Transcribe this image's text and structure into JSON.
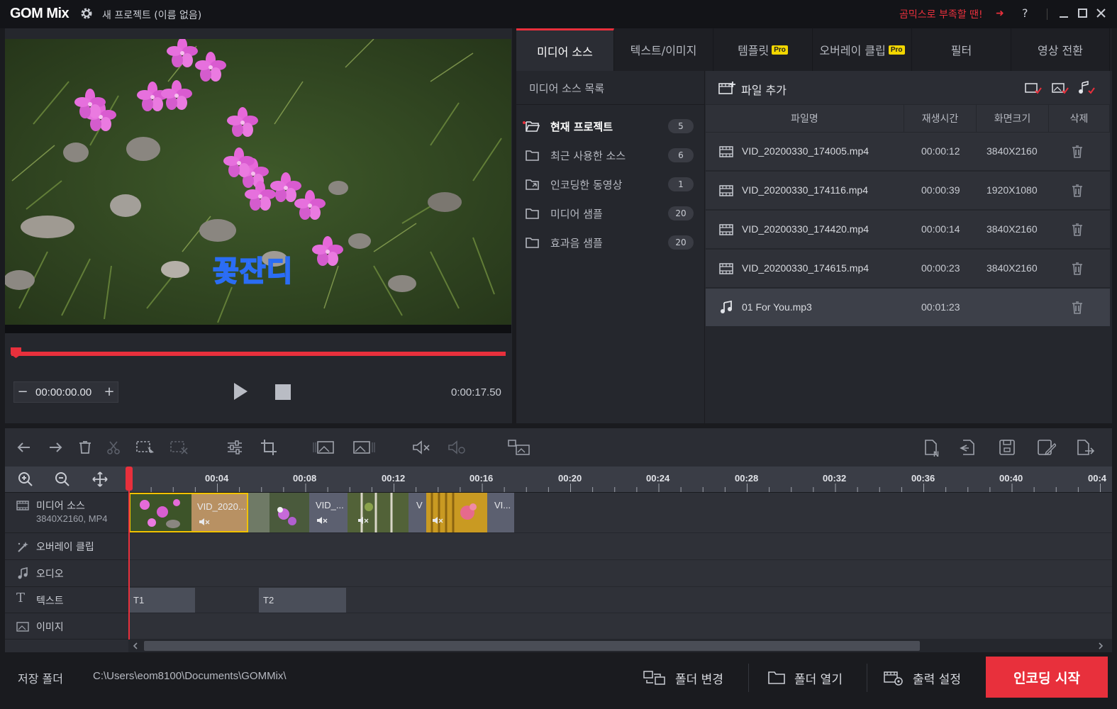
{
  "titlebar": {
    "app_name": "GOM Mix",
    "project_title": "새 프로젝트 (이름 없음)",
    "promo": "곰믹스로 부족할 땐! ",
    "promo_arrow": "➜",
    "help": "?"
  },
  "preview": {
    "caption": "꽃잔디",
    "timecode": "00:00:00.00",
    "duration": "0:00:17.50",
    "minus": "−",
    "plus": "+"
  },
  "tabs": [
    {
      "label": "미디어 소스",
      "pro": false
    },
    {
      "label": "텍스트/이미지",
      "pro": false
    },
    {
      "label": "템플릿",
      "pro": true
    },
    {
      "label": "오버레이 클립",
      "pro": true
    },
    {
      "label": "필터",
      "pro": false
    },
    {
      "label": "영상 전환",
      "pro": false
    }
  ],
  "pro_badge": "Pro",
  "source_list": {
    "title": "미디어 소스 목록",
    "items": [
      {
        "label": "현재 프로젝트",
        "count": "5"
      },
      {
        "label": "최근 사용한 소스",
        "count": "6"
      },
      {
        "label": "인코딩한 동영상",
        "count": "1"
      },
      {
        "label": "미디어 샘플",
        "count": "20"
      },
      {
        "label": "효과음 샘플",
        "count": "20"
      }
    ]
  },
  "files": {
    "add_label": "파일 추가",
    "columns": [
      "파일명",
      "재생시간",
      "화면크기",
      "삭제"
    ],
    "rows": [
      {
        "type": "video",
        "name": "VID_20200330_174005.mp4",
        "duration": "00:00:12",
        "size": "3840X2160"
      },
      {
        "type": "video",
        "name": "VID_20200330_174116.mp4",
        "duration": "00:00:39",
        "size": "1920X1080"
      },
      {
        "type": "video",
        "name": "VID_20200330_174420.mp4",
        "duration": "00:00:14",
        "size": "3840X2160"
      },
      {
        "type": "video",
        "name": "VID_20200330_174615.mp4",
        "duration": "00:00:23",
        "size": "3840X2160"
      },
      {
        "type": "audio",
        "name": "01 For You.mp3",
        "duration": "00:01:23",
        "size": ""
      }
    ]
  },
  "timeline": {
    "ruler": [
      "00:04",
      "00:08",
      "00:12",
      "00:16",
      "00:20",
      "00:24",
      "00:28",
      "00:32",
      "00:36",
      "00:40",
      "00:4"
    ],
    "tracks": {
      "media": {
        "name": "미디어 소스",
        "sub": "3840X2160, MP4"
      },
      "overlay": {
        "name": "오버레이 클립"
      },
      "audio": {
        "name": "오디오"
      },
      "text": {
        "name": "텍스트"
      },
      "image": {
        "name": "이미지"
      }
    },
    "clips": [
      "VID_2020...",
      "VID_...",
      "V",
      "VI..."
    ],
    "text_clips": [
      "T1",
      "T2"
    ]
  },
  "bottom": {
    "save_folder_label": "저장 폴더",
    "save_path": "C:\\Users\\eom8100\\Documents\\GOMMix\\",
    "change_folder": "폴더 변경",
    "open_folder": "폴더 열기",
    "output_settings": "출력 설정",
    "encode": "인코딩 시작"
  },
  "colors": {
    "accent": "#e8303c",
    "pro_badge": "#f2d600",
    "selected_clip_border": "#f2c200"
  }
}
